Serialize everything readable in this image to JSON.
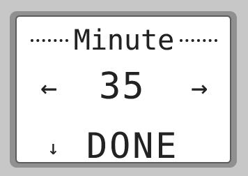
{
  "display": {
    "title": "Minute",
    "value": "35",
    "left_arrow": "←",
    "right_arrow": "→",
    "down_arrow": "↓",
    "done_label": "DONE"
  },
  "icons": {
    "left": "arrow-left-icon",
    "right": "arrow-right-icon",
    "down": "arrow-down-icon"
  },
  "colors": {
    "bezel": "#c7c7c7",
    "frame": "#909090",
    "screen": "#ffffff",
    "pixels": "#222222"
  }
}
